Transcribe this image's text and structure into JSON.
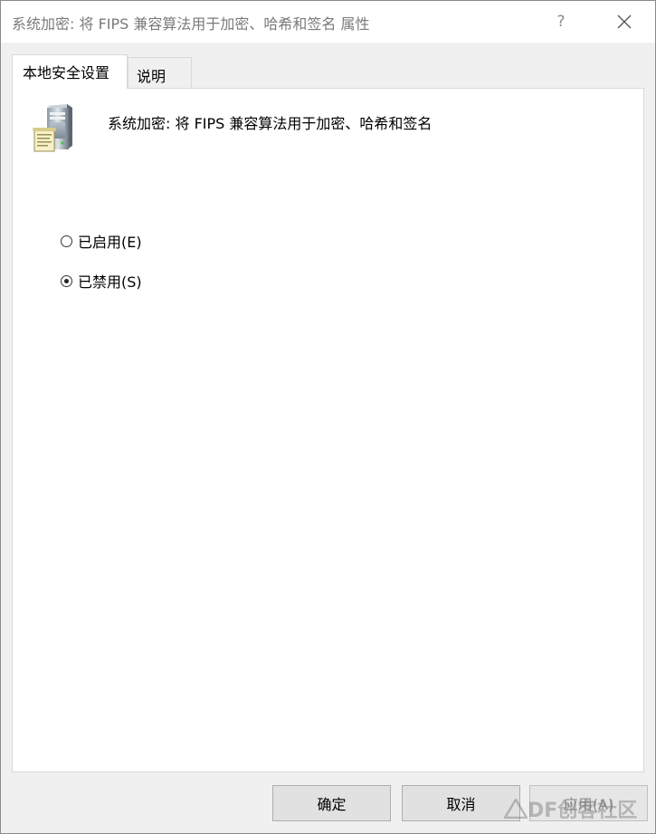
{
  "window": {
    "title": "系统加密: 将 FIPS 兼容算法用于加密、哈希和签名 属性",
    "help_label": "?"
  },
  "tabs": [
    {
      "label": "本地安全设置",
      "active": true
    },
    {
      "label": "说明",
      "active": false
    }
  ],
  "policy": {
    "icon": "server-icon",
    "name": "系统加密: 将 FIPS 兼容算法用于加密、哈希和签名"
  },
  "options": {
    "enabled": {
      "label": "已启用(E)",
      "checked": false
    },
    "disabled": {
      "label": "已禁用(S)",
      "checked": true
    }
  },
  "buttons": {
    "ok": "确定",
    "cancel": "取消",
    "apply": "应用(A)"
  },
  "watermark": {
    "text": "DF创客社区"
  },
  "colors": {
    "title_text": "#7a7a7a",
    "panel_bg": "#ffffff",
    "dialog_bg": "#f0f0f0",
    "button_bg": "#e1e1e1"
  }
}
